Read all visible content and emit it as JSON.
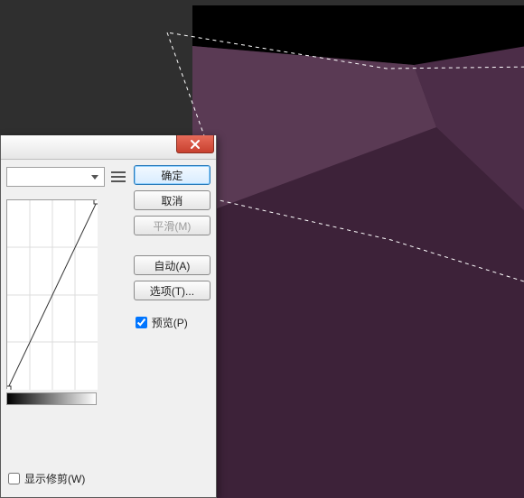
{
  "canvas": {
    "colors": {
      "bg_dark": "#2f2f2f",
      "black": "#000000",
      "purple_light": "#5a3a54",
      "purple_mid": "#4c2d48",
      "purple_dark": "#3d2239"
    }
  },
  "dialog": {
    "buttons": {
      "ok": "确定",
      "cancel": "取消",
      "smooth": "平滑(M)",
      "auto": "自动(A)",
      "options": "选项(T)..."
    },
    "preview": {
      "label": "预览(P)",
      "checked": true
    },
    "show_clipping": {
      "label": "显示修剪(W)",
      "checked": false
    }
  }
}
